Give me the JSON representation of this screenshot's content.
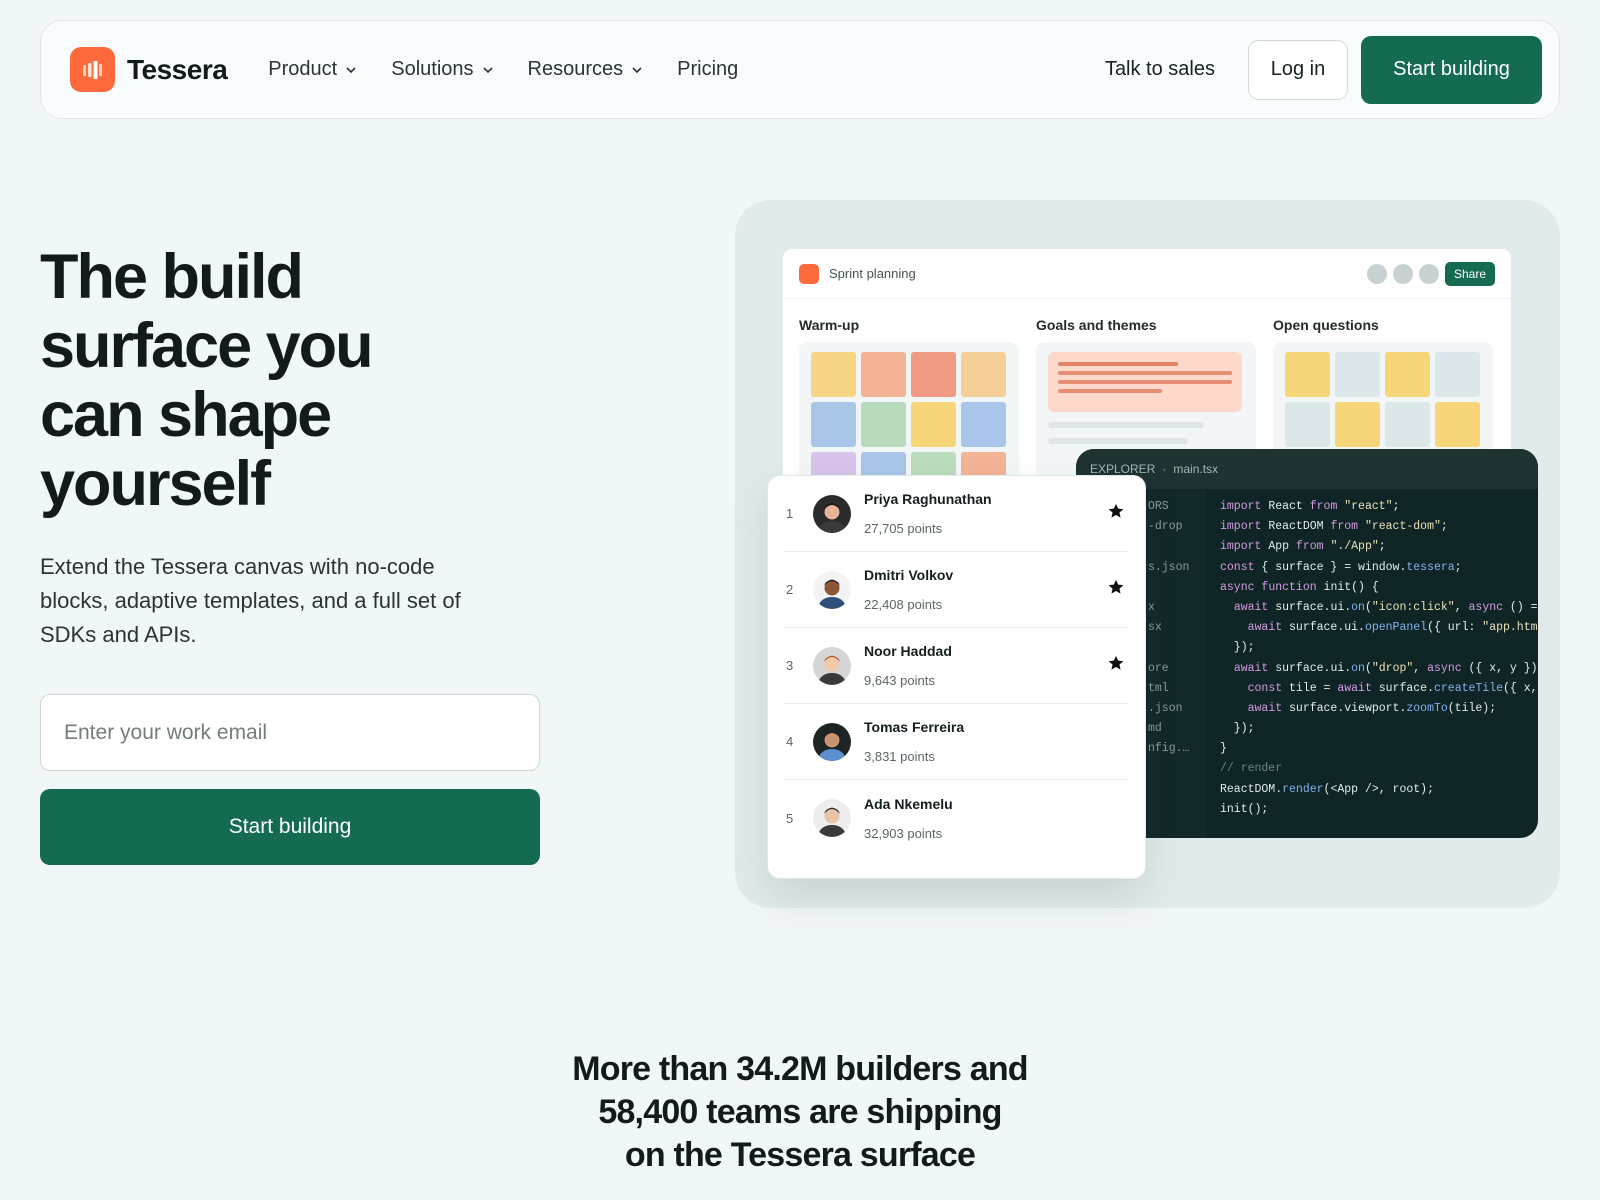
{
  "brand": {
    "name": "Tessera",
    "accent": "#ff6a3d",
    "primary": "#146b52"
  },
  "nav": {
    "links": [
      {
        "label": "Product",
        "has_dropdown": true
      },
      {
        "label": "Solutions",
        "has_dropdown": true
      },
      {
        "label": "Resources",
        "has_dropdown": true
      },
      {
        "label": "Pricing",
        "has_dropdown": false
      }
    ],
    "talk_to_sales": "Talk to sales",
    "login": "Log in",
    "cta": "Start building"
  },
  "hero": {
    "title_lines": [
      "The build",
      "surface you",
      "can shape",
      "yourself"
    ],
    "subtitle": "Extend the Tessera canvas with no-code blocks, adaptive templates, and a full set of SDKs and APIs.",
    "email_placeholder": "Enter your work email",
    "cta": "Start building"
  },
  "board": {
    "title": "Sprint planning",
    "share_label": "Share",
    "columns": [
      "Warm-up",
      "Goals and themes",
      "Open questions"
    ]
  },
  "code": {
    "header_left": "EXPLORER",
    "header_sep": "·",
    "header_file": "main.tsx",
    "explorer_items": [
      "ORS",
      "-drop",
      "",
      "s.json",
      "",
      "x",
      "sx",
      "",
      "ore",
      "tml",
      ".json",
      "md",
      "nfig.…"
    ],
    "lines": [
      "import React from \"react\";",
      "import ReactDOM from \"react-dom\";",
      "import App from \"./App\";",
      "const { surface } = window.tessera;",
      "async function init() {",
      "  await surface.ui.on(\"icon:click\", async () =>",
      "    await surface.ui.openPanel({ url: \"app.html\"",
      "  });",
      "  await surface.ui.on(\"drop\", async ({ x, y }) =>",
      "    const tile = await surface.createTile({ x, y",
      "    await surface.viewport.zoomTo(tile);",
      "  });",
      "}",
      "// render",
      "ReactDOM.render(<App />, root);",
      "init();"
    ]
  },
  "leaderboard": [
    {
      "rank": "1",
      "name": "Priya Raghunathan",
      "points": "27,705 points",
      "starred": true,
      "avatar_bg": "#2a2a2a",
      "skin": "#e7b49a",
      "hair": "#111111"
    },
    {
      "rank": "2",
      "name": "Dmitri Volkov",
      "points": "22,408 points",
      "starred": true,
      "avatar_bg": "#f3f3f3",
      "skin": "#8a5535",
      "hair": "#1b1b1b"
    },
    {
      "rank": "3",
      "name": "Noor Haddad",
      "points": "9,643 points",
      "starred": true,
      "avatar_bg": "#d6d6d6",
      "skin": "#f0c8a8",
      "hair": "#b4542c"
    },
    {
      "rank": "4",
      "name": "Tomas Ferreira",
      "points": "3,831 points",
      "starred": false,
      "avatar_bg": "#1d2424",
      "skin": "#c89474",
      "hair": "#2b1b14"
    },
    {
      "rank": "5",
      "name": "Ada Nkemelu",
      "points": "32,903 points",
      "starred": false,
      "avatar_bg": "#ededed",
      "skin": "#e8c3a8",
      "hair": "#222222"
    }
  ],
  "stats": {
    "lines": [
      "More than 34.2M builders and",
      "58,400 teams are shipping",
      "on the Tessera surface"
    ]
  }
}
